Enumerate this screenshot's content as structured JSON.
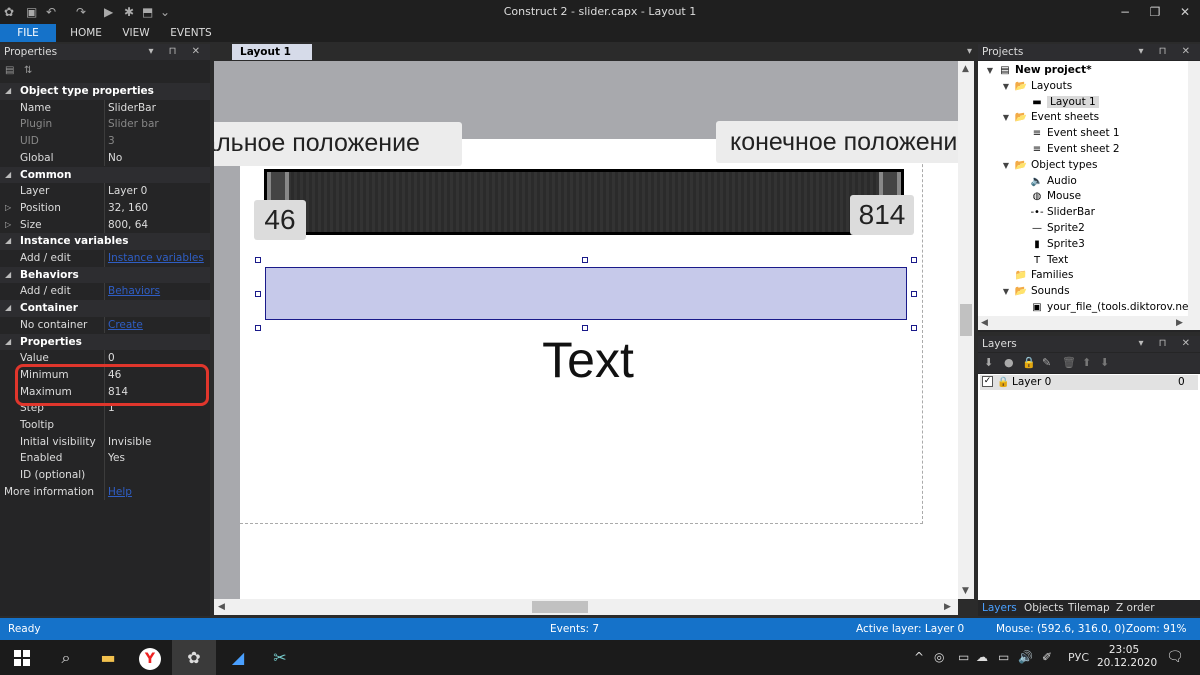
{
  "window": {
    "title": "Construct 2 - slider.capx - Layout 1",
    "minimize": "−",
    "restore": "❐",
    "close": "✕"
  },
  "quick_access": [
    "✿",
    "▣",
    "↶",
    "↷",
    "▶",
    "✱",
    "⬒",
    "⌄"
  ],
  "ribbon": {
    "tabs": [
      "FILE",
      "HOME",
      "VIEW",
      "EVENTS"
    ]
  },
  "properties": {
    "panel_title": "Properties",
    "panel_controls": "▾ ⊓ ✕",
    "rows": [
      {
        "name": "Object type properties",
        "value": "",
        "cat": true
      },
      {
        "name": "Name",
        "value": "SliderBar"
      },
      {
        "name": "Plugin",
        "value": "Slider bar",
        "dim": true
      },
      {
        "name": "UID",
        "value": "3",
        "dim": true
      },
      {
        "name": "Global",
        "value": "No"
      },
      {
        "name": "Common",
        "value": "",
        "cat": true
      },
      {
        "name": "Layer",
        "value": "Layer 0"
      },
      {
        "name": "Position",
        "value": "32, 160",
        "expand": true
      },
      {
        "name": "Size",
        "value": "800, 64",
        "expand": true
      },
      {
        "name": "Instance variables",
        "value": "",
        "cat": true
      },
      {
        "name": "Add / edit",
        "value": "Instance variables",
        "link": true
      },
      {
        "name": "Behaviors",
        "value": "",
        "cat": true
      },
      {
        "name": "Add / edit",
        "value": "Behaviors",
        "link": true
      },
      {
        "name": "Container",
        "value": "",
        "cat": true
      },
      {
        "name": "No container",
        "value": "Create",
        "link": true
      },
      {
        "name": "Properties",
        "value": "",
        "cat": true
      },
      {
        "name": "Value",
        "value": "0"
      },
      {
        "name": "Minimum",
        "value": "46"
      },
      {
        "name": "Maximum",
        "value": "814"
      },
      {
        "name": "Step",
        "value": "1"
      },
      {
        "name": "Tooltip",
        "value": ""
      },
      {
        "name": "Initial visibility",
        "value": "Invisible"
      },
      {
        "name": "Enabled",
        "value": "Yes"
      },
      {
        "name": "ID (optional)",
        "value": ""
      },
      {
        "name": "More information",
        "value": "Help",
        "link": true,
        "noindent": true
      }
    ]
  },
  "document": {
    "tab": "Layout 1",
    "callout_start": "начальное положение",
    "callout_end": "конечное положение",
    "badge_min": "46",
    "badge_max": "814",
    "text_object": "Text"
  },
  "projects": {
    "panel_title": "Projects",
    "tree": [
      {
        "label": "New project*",
        "depth": 0,
        "bold": true,
        "toggle": "▼",
        "icon": "▤"
      },
      {
        "label": "Layouts",
        "depth": 1,
        "toggle": "▼",
        "icon": "📂"
      },
      {
        "label": "Layout 1",
        "depth": 2,
        "icon": "▬",
        "selected": true
      },
      {
        "label": "Event sheets",
        "depth": 1,
        "toggle": "▼",
        "icon": "📂"
      },
      {
        "label": "Event sheet 1",
        "depth": 2,
        "icon": "≡"
      },
      {
        "label": "Event sheet 2",
        "depth": 2,
        "icon": "≡"
      },
      {
        "label": "Object types",
        "depth": 1,
        "toggle": "▼",
        "icon": "📂"
      },
      {
        "label": "Audio",
        "depth": 2,
        "icon": "🔈"
      },
      {
        "label": "Mouse",
        "depth": 2,
        "icon": "◍"
      },
      {
        "label": "SliderBar",
        "depth": 2,
        "icon": "-•-"
      },
      {
        "label": "Sprite2",
        "depth": 2,
        "icon": "—"
      },
      {
        "label": "Sprite3",
        "depth": 2,
        "icon": "▮"
      },
      {
        "label": "Text",
        "depth": 2,
        "icon": "T"
      },
      {
        "label": "Families",
        "depth": 1,
        "icon": "📁"
      },
      {
        "label": "Sounds",
        "depth": 1,
        "toggle": "▼",
        "icon": "📂"
      },
      {
        "label": "your_file_(tools.diktorov.net).ogg",
        "depth": 2,
        "icon": "▣"
      }
    ]
  },
  "layers": {
    "panel_title": "Layers",
    "toolbar_icons": [
      "⬇",
      "●",
      "🔒",
      "✎",
      "🗑",
      "⬆",
      "⬇"
    ],
    "row": {
      "name": "Layer 0",
      "index": "0"
    }
  },
  "bottom_tabs": [
    "Layers",
    "Objects",
    "Tilemap",
    "Z order"
  ],
  "status": {
    "ready": "Ready",
    "events": "Events: 7",
    "active_layer": "Active layer: Layer 0",
    "mouse": "Mouse: (592.6, 316.0, 0)",
    "zoom": "Zoom: 91%"
  },
  "taskbar": {
    "icons": [
      "windows-logo",
      "search",
      "file-explorer",
      "yandex-browser",
      "construct2",
      "app-blue",
      "app-screenshot"
    ],
    "tray_glyphs": [
      "^",
      "◎",
      "▭",
      "☁",
      "▭",
      "🔊",
      "✐"
    ],
    "lang": "РУС",
    "time": "23:05",
    "date": "20.12.2020",
    "notif": "🗨"
  },
  "colors": {
    "accent_blue": "#1572c9",
    "highlight_red": "#e0362c",
    "selection_fill": "#c6c9ea"
  }
}
